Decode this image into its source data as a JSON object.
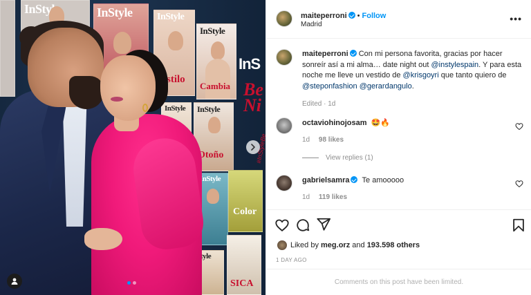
{
  "photo": {
    "magazine_title": "InStyle",
    "cover_words": [
      "Estilo",
      "Cambia",
      "Otoño",
      "Color",
      "SICA"
    ],
    "banner_text": "InS",
    "banner_red": "Be\nNi",
    "hashtag": "#InStyleBe",
    "carousel_dots": 2,
    "active_dot": 0
  },
  "header": {
    "username": "maiteperroni",
    "follow_label": "Follow",
    "separator": "•",
    "location": "Madrid",
    "more_label": "•••"
  },
  "caption": {
    "username": "maiteperroni",
    "text_1": "Con mi persona favorita, gracias por hacer sonreír así a mi alma… date night out ",
    "mention_1": "@instylespain",
    "text_2": ". Y para esta noche me lleve un vestido de ",
    "mention_2": "@krisgoyri",
    "text_3": " que tanto quiero de ",
    "mention_3": "@steponfashion",
    "text_4": " ",
    "mention_4": "@gerardangulo",
    "text_5": ".",
    "meta": "Edited · 1d"
  },
  "comments": [
    {
      "username": "octaviohinojosam",
      "text": "🤩🔥",
      "time": "1d",
      "likes": "98 likes",
      "view_replies": "View replies (1)"
    },
    {
      "username": "gabrielsamra",
      "text": "Te amooooo",
      "time": "1d",
      "likes": "119 likes"
    }
  ],
  "likes": {
    "prefix": "Liked by ",
    "user": "meg.orz",
    "middle": " and ",
    "count": "193.598 others"
  },
  "posted_ago": "1 DAY AGO",
  "comments_limited": "Comments on this post have been limited.",
  "colors": {
    "accent": "#0095f6",
    "link": "#00376b",
    "dress": "#f01a7a",
    "magazine_red": "#c8102e"
  },
  "icons": [
    "verified-icon",
    "heart-icon",
    "comment-icon",
    "share-icon",
    "bookmark-icon",
    "more-icon",
    "next-arrow-icon",
    "user-tag-icon"
  ]
}
